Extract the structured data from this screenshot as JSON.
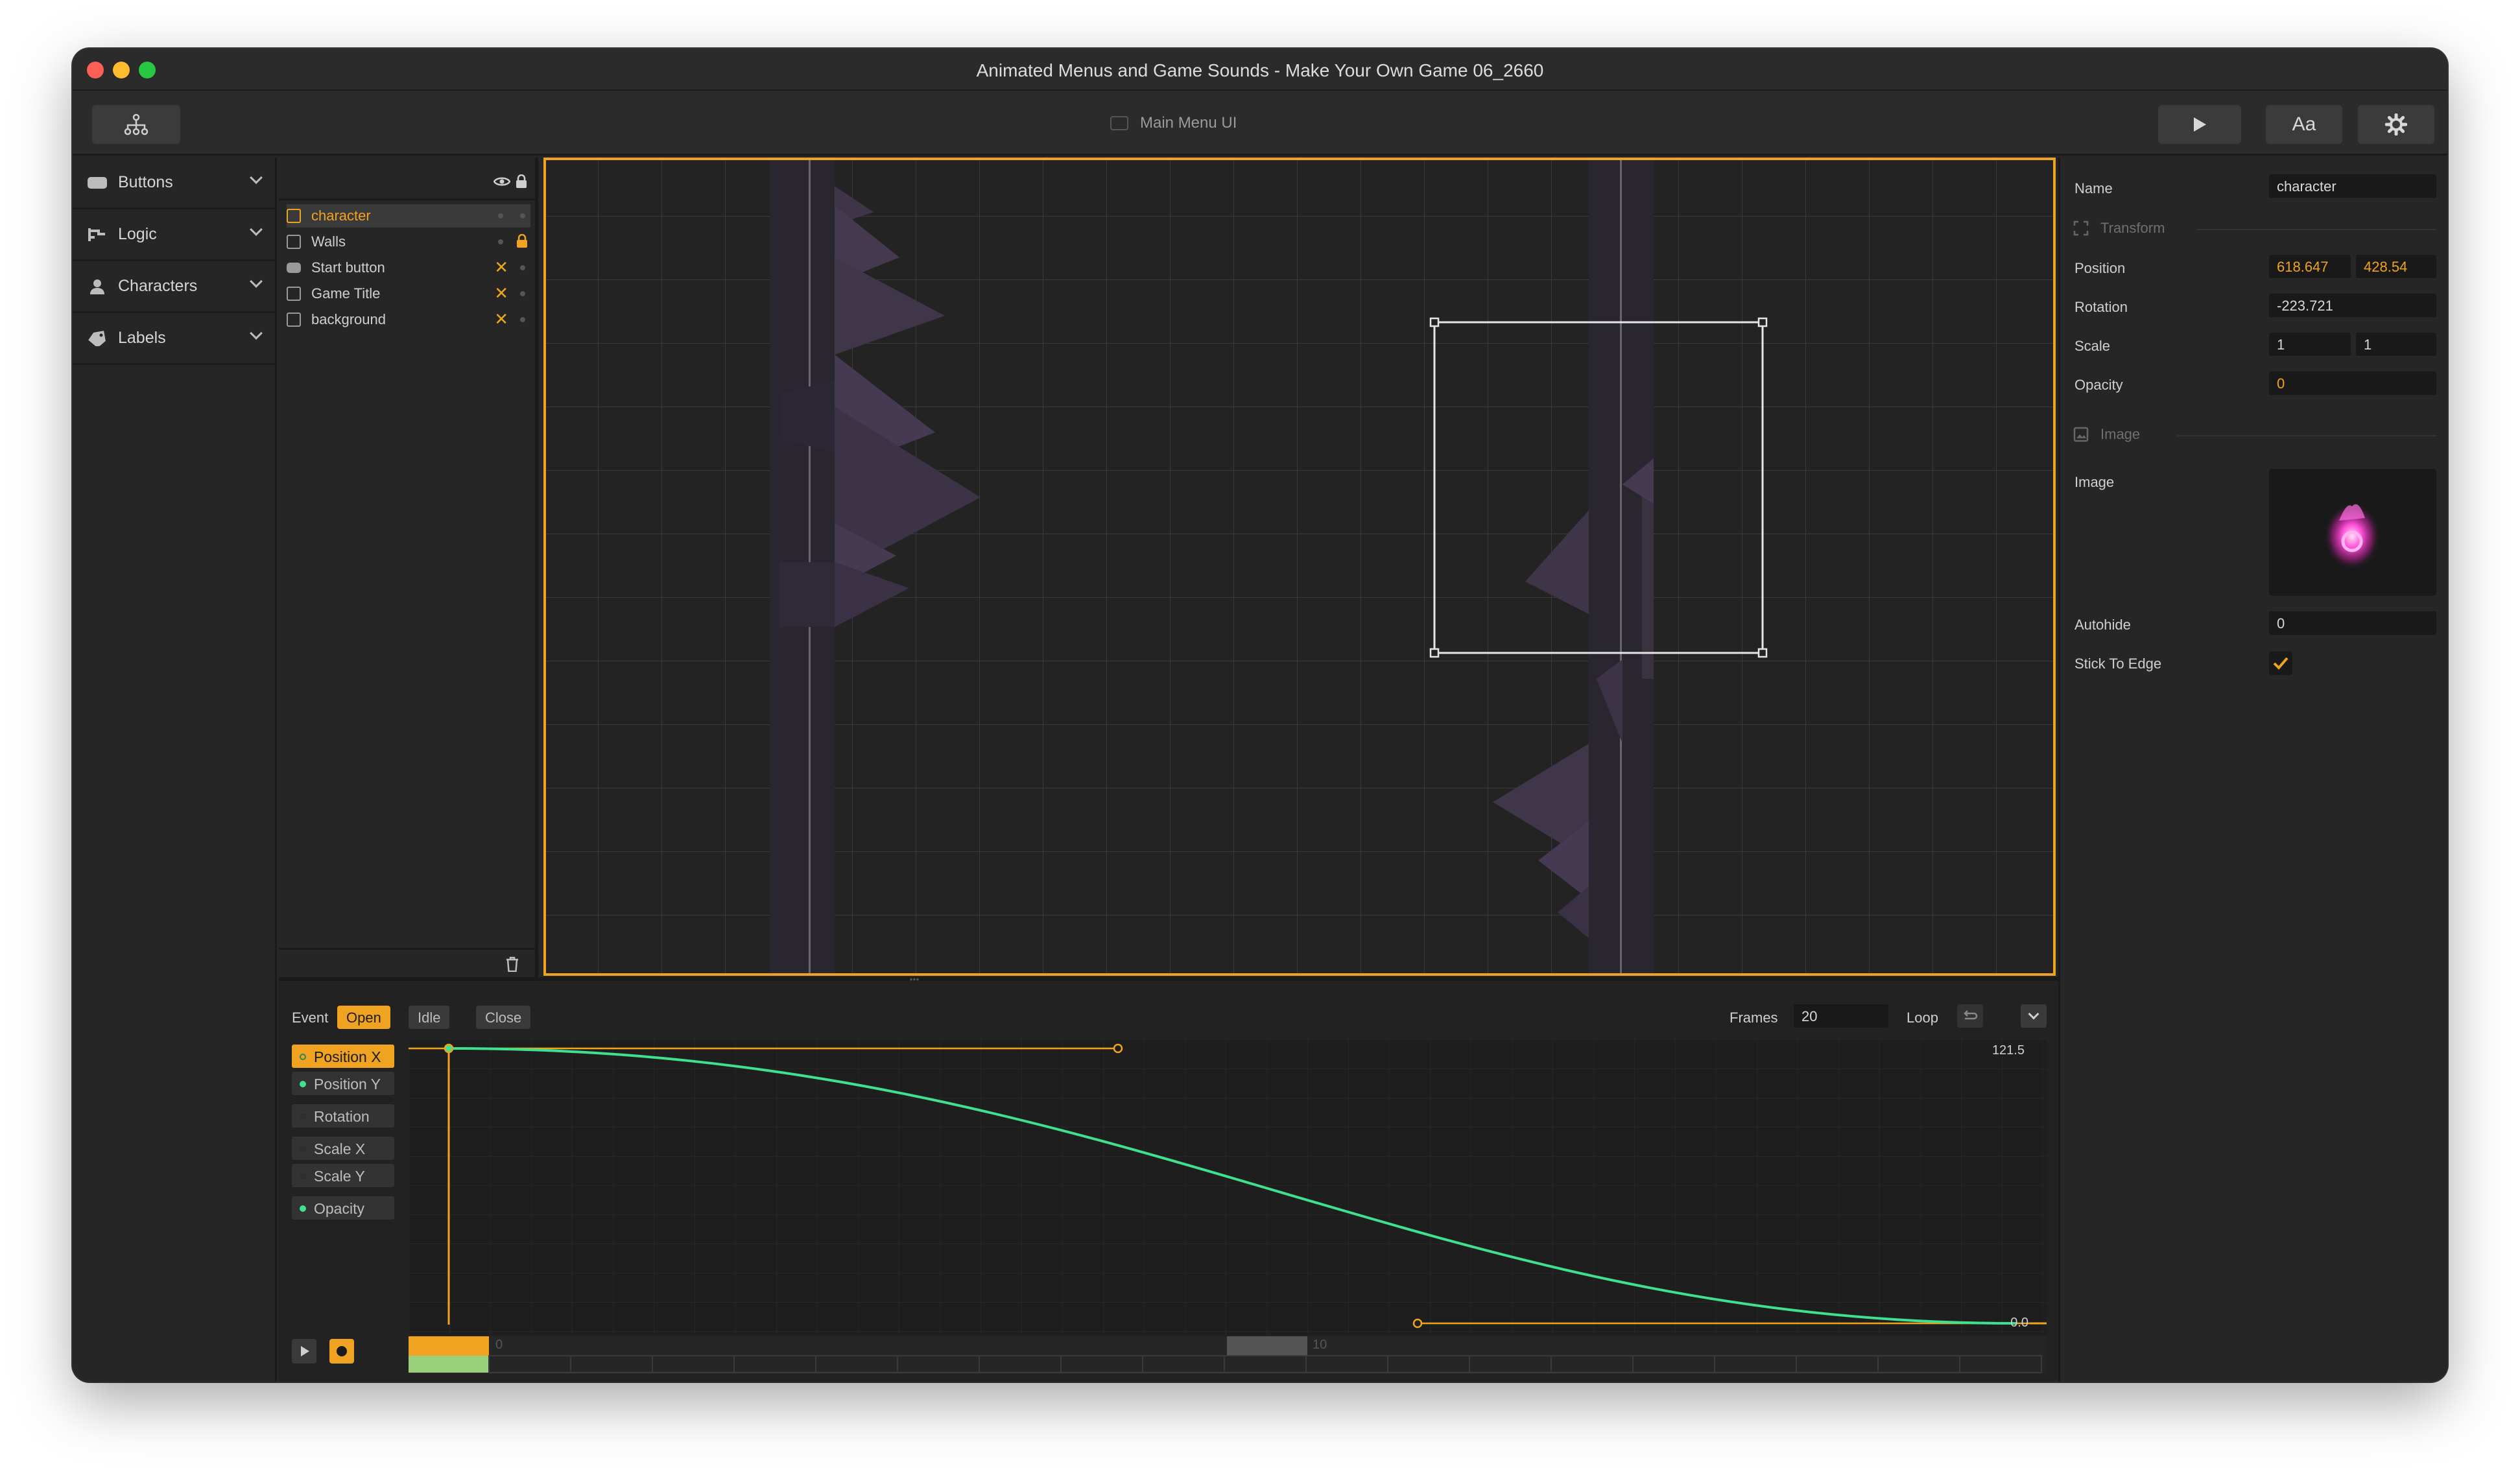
{
  "window": {
    "title": "Animated Menus and Game Sounds - Make Your Own Game 06_2660"
  },
  "toolbar": {
    "scene_title": "Main Menu UI",
    "font_button": "Aa"
  },
  "sidebar": {
    "categories": [
      {
        "label": "Buttons",
        "icon": "button-icon"
      },
      {
        "label": "Logic",
        "icon": "logic-icon"
      },
      {
        "label": "Characters",
        "icon": "person-icon"
      },
      {
        "label": "Labels",
        "icon": "tag-icon"
      }
    ]
  },
  "layers": {
    "items": [
      {
        "name": "character",
        "selected": true,
        "icon": "image-icon"
      },
      {
        "name": "Walls",
        "locked": true,
        "icon": "image-icon"
      },
      {
        "name": "Start button",
        "icon": "button-icon"
      },
      {
        "name": "Game Title",
        "icon": "image-icon"
      },
      {
        "name": "background",
        "icon": "image-icon"
      }
    ]
  },
  "properties": {
    "name_label": "Name",
    "name_value": "character",
    "transform_section": "Transform",
    "position_label": "Position",
    "position_x": "618.647",
    "position_y": "428.54",
    "rotation_label": "Rotation",
    "rotation_value": "-223.721",
    "scale_label": "Scale",
    "scale_x": "1",
    "scale_y": "1",
    "opacity_label": "Opacity",
    "opacity_value": "0",
    "image_section": "Image",
    "image_label": "Image",
    "autohide_label": "Autohide",
    "autohide_value": "0",
    "stick_label": "Stick To Edge",
    "stick_checked": true
  },
  "timeline": {
    "event_label": "Event",
    "events": [
      "Open",
      "Idle",
      "Close"
    ],
    "active_event": "Open",
    "frames_label": "Frames",
    "frames_value": "20",
    "loop_label": "Loop",
    "tracks": [
      {
        "label": "Position X",
        "active": true,
        "has_keys": true
      },
      {
        "label": "Position Y",
        "has_keys": true
      },
      {
        "label": "Rotation",
        "has_keys": false
      },
      {
        "label": "Scale X",
        "has_keys": false
      },
      {
        "label": "Scale Y",
        "has_keys": false
      },
      {
        "label": "Opacity",
        "has_keys": true
      }
    ],
    "curve_max_label": "121.5",
    "curve_min_label": "0.0",
    "ruler_labels": [
      "0",
      "10"
    ]
  },
  "colors": {
    "accent": "#f0a321",
    "curve": "#3fe08f",
    "panel": "#262626",
    "canvas": "#232323"
  }
}
